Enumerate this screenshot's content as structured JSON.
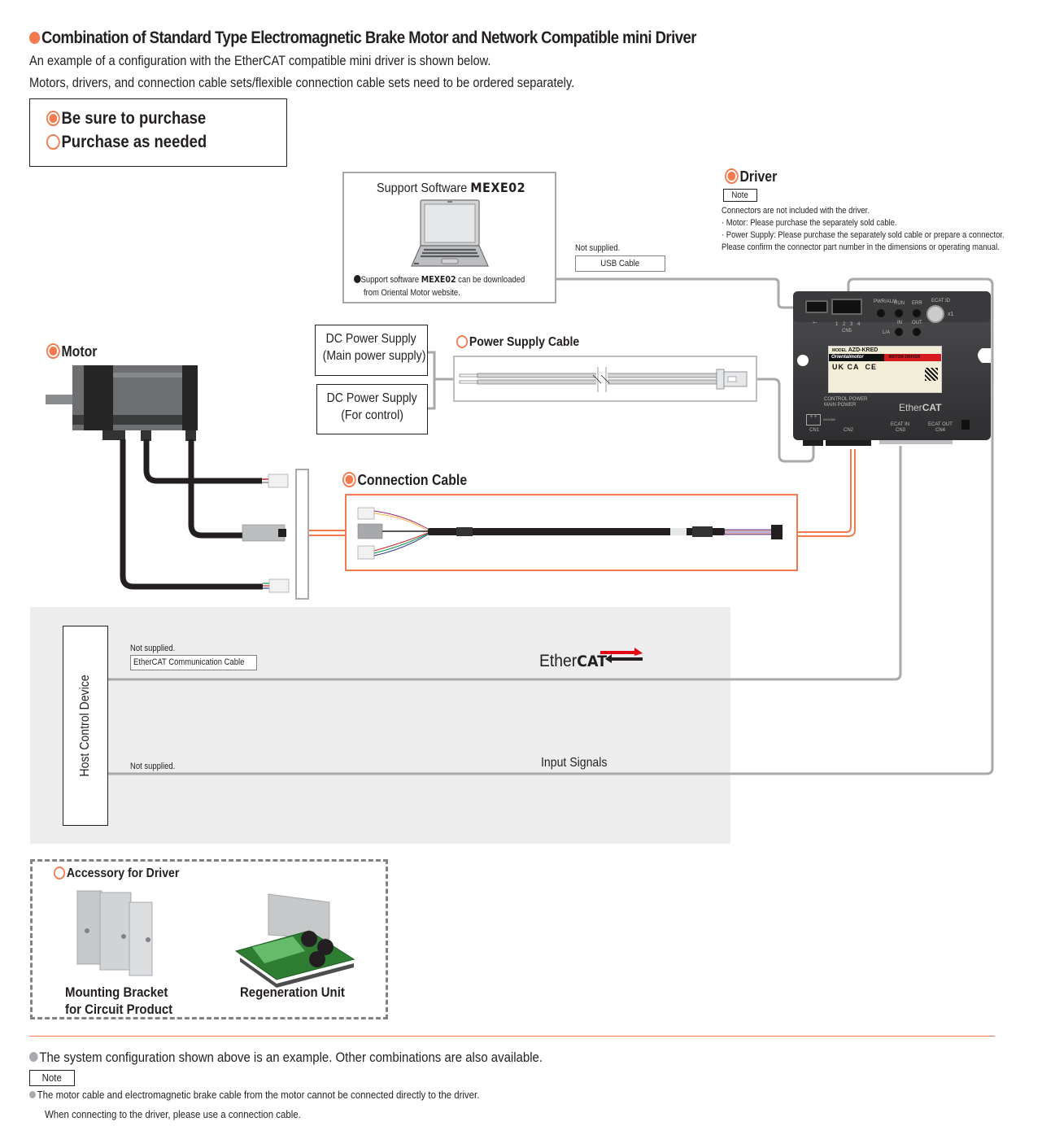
{
  "header": {
    "title": "Combination of Standard Type Electromagnetic Brake Motor and Network Compatible mini Driver",
    "line1": "An example of a configuration with the EtherCAT compatible mini driver is shown below.",
    "line2": "Motors, drivers, and connection cable sets/flexible connection cable sets need to be ordered separately."
  },
  "legend": {
    "required": "Be sure to purchase",
    "optional": "Purchase as needed"
  },
  "colors": {
    "accent": "#f37a4f",
    "line_gray": "#a7a9ac",
    "text": "#231f20",
    "host_area_bg": "#ededee",
    "ethercat_red": "#e30613"
  },
  "software": {
    "title_prefix": "Support Software",
    "title_product": "MEXE02",
    "note_prefix": "Support software",
    "note_product": "MEXE02",
    "note_suffix": "can be downloaded",
    "note_line2": "from Oriental Motor website.",
    "icon": "laptop-icon"
  },
  "usb_cable": {
    "supply_note": "Not supplied.",
    "label": "USB Cable"
  },
  "driver": {
    "label": "Driver",
    "purchase": "required",
    "note_tag": "Note",
    "notes": [
      "Connectors are not included with the driver.",
      "· Motor: Please purchase the separately sold cable.",
      "· Power Supply: Please purchase the separately sold cable or prepare a connector.",
      "Please confirm the connector part number in the dimensions or operating manual."
    ],
    "panel": {
      "model_prefix": "MODEL",
      "model": "AZD-KRED",
      "brand": "Orientalmotor",
      "type": "MOTOR DRIVER",
      "led_labels": [
        "PWR/ALM",
        "RUN",
        "ERR",
        "IN",
        "OUT",
        "L/A"
      ],
      "ecat_id": "ECAT ID",
      "ecat_id_mult": "x1",
      "cn5_pins": "1 2 3 4",
      "cn5": "CN5",
      "power_labels": [
        "CONTROL POWER",
        "MAIN POWER"
      ],
      "voltage": "24V/48V",
      "connectors": [
        "CN1",
        "CN2",
        "ECAT IN",
        "CN3",
        "ECAT OUT",
        "CN4"
      ],
      "logo": "EtherCAT",
      "cert_marks": [
        "UK CA",
        "CE"
      ]
    }
  },
  "power": {
    "main_line1": "DC Power Supply",
    "main_line2": "(Main power supply)",
    "ctrl_line1": "DC Power Supply",
    "ctrl_line2": "(For control)",
    "cable_label": "Power Supply Cable",
    "cable_purchase": "optional"
  },
  "motor": {
    "label": "Motor",
    "purchase": "required"
  },
  "connection_cable": {
    "label": "Connection Cable",
    "purchase": "required"
  },
  "host": {
    "label": "Host Control Device",
    "ethercat_supply_note": "Not supplied.",
    "ethercat_cable": "EtherCAT Communication Cable",
    "ethercat_logo_plain": "Ether",
    "ethercat_logo_bold": "CAT",
    "signals_supply_note": "Not supplied.",
    "signals_label": "Input Signals"
  },
  "accessory": {
    "title": "Accessory for Driver",
    "purchase": "optional",
    "items": [
      {
        "line1": "Mounting Bracket",
        "line2": "for Circuit Product"
      },
      {
        "line1": "Regeneration Unit",
        "line2": ""
      }
    ]
  },
  "footer": {
    "line1": "The system configuration shown above is an example. Other combinations are also available.",
    "note_tag": "Note",
    "note1": "The motor cable and electromagnetic brake cable from the motor cannot be connected directly to the driver.",
    "note2": "When connecting to the driver, please use a connection cable."
  }
}
